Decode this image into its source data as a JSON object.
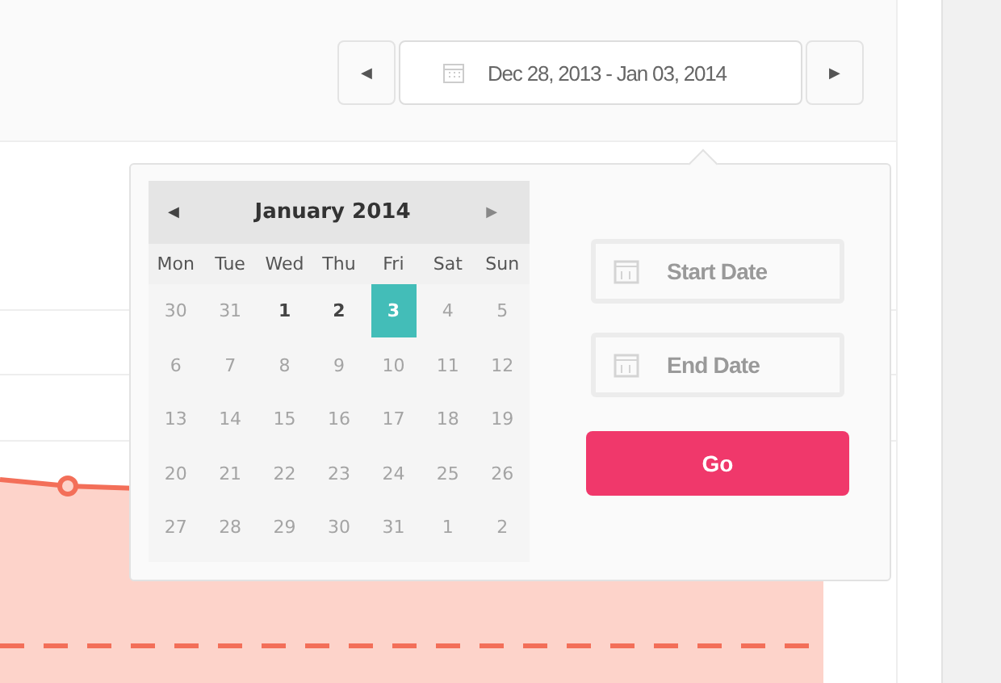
{
  "date_range": {
    "prev": "◀",
    "label": "Dec 28, 2013 - Jan 03, 2014",
    "next": "▶"
  },
  "calendar": {
    "prev": "◀",
    "next": "▶",
    "month": "January 2014",
    "weekdays": [
      "Mon",
      "Tue",
      "Wed",
      "Thu",
      "Fri",
      "Sat",
      "Sun"
    ],
    "days": [
      {
        "label": "30",
        "disabled": true,
        "selected": false
      },
      {
        "label": "31",
        "disabled": true,
        "selected": false
      },
      {
        "label": "1",
        "disabled": false,
        "selected": false
      },
      {
        "label": "2",
        "disabled": false,
        "selected": false
      },
      {
        "label": "3",
        "disabled": false,
        "selected": true
      },
      {
        "label": "4",
        "disabled": true,
        "selected": false
      },
      {
        "label": "5",
        "disabled": true,
        "selected": false
      },
      {
        "label": "6",
        "disabled": true,
        "selected": false
      },
      {
        "label": "7",
        "disabled": true,
        "selected": false
      },
      {
        "label": "8",
        "disabled": true,
        "selected": false
      },
      {
        "label": "9",
        "disabled": true,
        "selected": false
      },
      {
        "label": "10",
        "disabled": true,
        "selected": false
      },
      {
        "label": "11",
        "disabled": true,
        "selected": false
      },
      {
        "label": "12",
        "disabled": true,
        "selected": false
      },
      {
        "label": "13",
        "disabled": true,
        "selected": false
      },
      {
        "label": "14",
        "disabled": true,
        "selected": false
      },
      {
        "label": "15",
        "disabled": true,
        "selected": false
      },
      {
        "label": "16",
        "disabled": true,
        "selected": false
      },
      {
        "label": "17",
        "disabled": true,
        "selected": false
      },
      {
        "label": "18",
        "disabled": true,
        "selected": false
      },
      {
        "label": "19",
        "disabled": true,
        "selected": false
      },
      {
        "label": "20",
        "disabled": true,
        "selected": false
      },
      {
        "label": "21",
        "disabled": true,
        "selected": false
      },
      {
        "label": "22",
        "disabled": true,
        "selected": false
      },
      {
        "label": "23",
        "disabled": true,
        "selected": false
      },
      {
        "label": "24",
        "disabled": true,
        "selected": false
      },
      {
        "label": "25",
        "disabled": true,
        "selected": false
      },
      {
        "label": "26",
        "disabled": true,
        "selected": false
      },
      {
        "label": "27",
        "disabled": true,
        "selected": false
      },
      {
        "label": "28",
        "disabled": true,
        "selected": false
      },
      {
        "label": "29",
        "disabled": true,
        "selected": false
      },
      {
        "label": "30",
        "disabled": true,
        "selected": false
      },
      {
        "label": "31",
        "disabled": true,
        "selected": false
      },
      {
        "label": "1",
        "disabled": true,
        "selected": false
      },
      {
        "label": "2",
        "disabled": true,
        "selected": false
      }
    ]
  },
  "start_date": {
    "placeholder": "Start Date"
  },
  "end_date": {
    "placeholder": "End Date"
  },
  "go_button": "Go"
}
